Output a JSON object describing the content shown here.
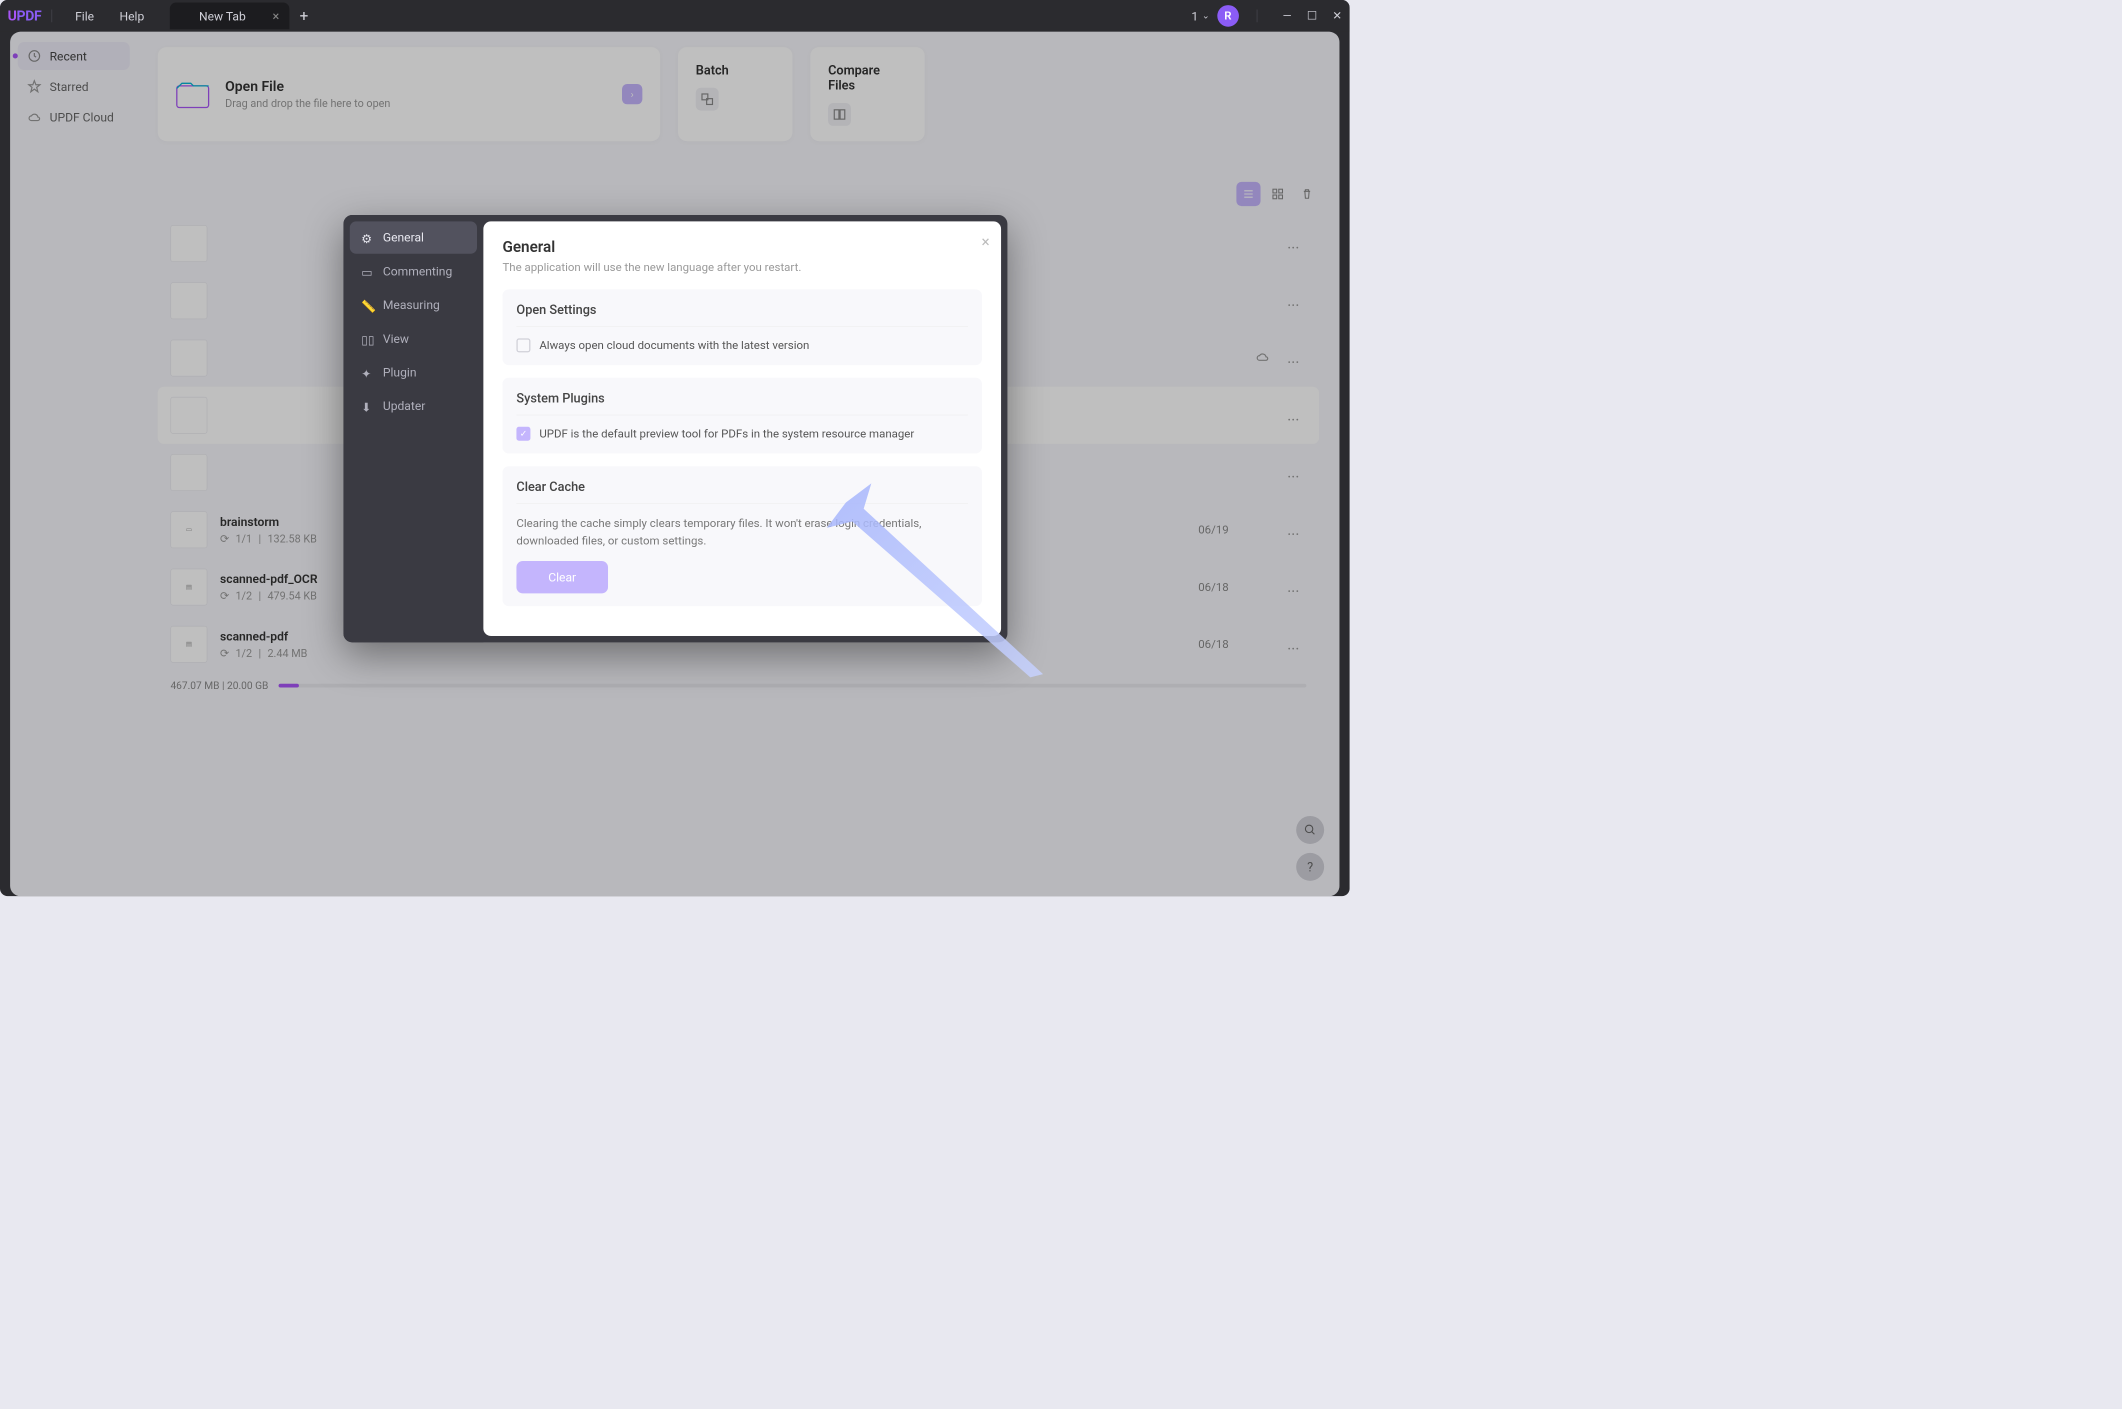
{
  "titlebar": {
    "logo": "UPDF",
    "menu": {
      "file": "File",
      "help": "Help"
    },
    "tab": {
      "title": "New Tab"
    },
    "counter": "1",
    "avatar": "R"
  },
  "sidebar": {
    "items": [
      {
        "label": "Recent",
        "icon": "clock"
      },
      {
        "label": "Starred",
        "icon": "star"
      },
      {
        "label": "UPDF Cloud",
        "icon": "cloud"
      }
    ]
  },
  "open_card": {
    "title": "Open File",
    "subtitle": "Drag and drop the file here to open"
  },
  "action_cards": {
    "batch": "Batch",
    "compare": "Compare Files"
  },
  "files": [
    {
      "name": "",
      "pages": "",
      "size": "",
      "date": "",
      "more": "..."
    },
    {
      "name": "",
      "pages": "",
      "size": "",
      "date": "",
      "more": "..."
    },
    {
      "name": "",
      "pages": "",
      "size": "",
      "date": "",
      "cloud": true,
      "more": "..."
    },
    {
      "name": "",
      "pages": "",
      "size": "",
      "date": "",
      "more": "..."
    },
    {
      "name": "",
      "pages": "",
      "size": "",
      "date": "",
      "more": "..."
    },
    {
      "name": "brainstorm",
      "pages": "1/1",
      "size": "132.58 KB",
      "date": "06/19",
      "more": "..."
    },
    {
      "name": "scanned-pdf_OCR",
      "pages": "1/2",
      "size": "479.54 KB",
      "date": "06/18",
      "more": "..."
    },
    {
      "name": "scanned-pdf",
      "pages": "1/2",
      "size": "2.44 MB",
      "date": "06/18",
      "more": "..."
    }
  ],
  "storage": {
    "text": "467.07 MB | 20.00 GB"
  },
  "modal": {
    "tabs": [
      {
        "label": "General"
      },
      {
        "label": "Commenting"
      },
      {
        "label": "Measuring"
      },
      {
        "label": "View"
      },
      {
        "label": "Plugin"
      },
      {
        "label": "Updater"
      }
    ],
    "title": "General",
    "lang_note": "The application will use the new language after you restart.",
    "open_settings": {
      "title": "Open Settings",
      "checkbox": "Always open cloud documents with the latest version"
    },
    "system_plugins": {
      "title": "System Plugins",
      "checkbox": "UPDF is the default preview tool for PDFs in the system resource manager"
    },
    "clear_cache": {
      "title": "Clear Cache",
      "desc": "Clearing the cache simply clears temporary files. It won't erase login credentials, downloaded files, or custom settings.",
      "button": "Clear"
    }
  }
}
